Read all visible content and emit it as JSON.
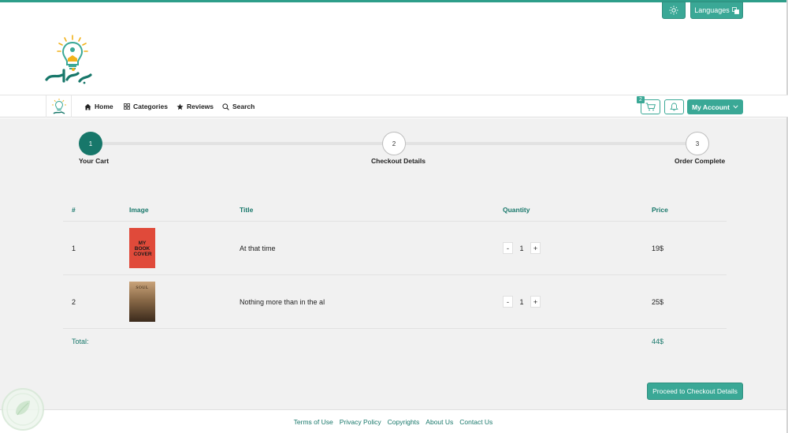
{
  "top": {
    "languages_label": "Languages"
  },
  "nav": {
    "items": [
      {
        "label": "Home",
        "icon": "home-icon"
      },
      {
        "label": "Categories",
        "icon": "grid-icon"
      },
      {
        "label": "Reviews",
        "icon": "star-icon"
      },
      {
        "label": "Search",
        "icon": "search-icon"
      }
    ],
    "cart_count": "2",
    "account_label": "My Account"
  },
  "steps": [
    {
      "number": "1",
      "label": "Your Cart",
      "active": true
    },
    {
      "number": "2",
      "label": "Checkout Details",
      "active": false
    },
    {
      "number": "3",
      "label": "Order Complete",
      "active": false
    }
  ],
  "table": {
    "headers": {
      "num": "#",
      "image": "Image",
      "title": "Title",
      "quantity": "Quantity",
      "price": "Price"
    },
    "rows": [
      {
        "num": "1",
        "cover_text": "MY BOOK COVER",
        "title": "At that time",
        "quantity": "1",
        "price": "19$"
      },
      {
        "num": "2",
        "cover_text": "SOUL",
        "title": "Nothing more than in the al",
        "quantity": "1",
        "price": "25$"
      }
    ],
    "minus": "-",
    "plus": "+",
    "total_label": "Total:",
    "total_value": "44$"
  },
  "proceed_label": "Proceed to Checkout Details",
  "footer": {
    "links": [
      "Terms of Use",
      "Privacy Policy",
      "Copyrights",
      "About Us",
      "Contact Us"
    ]
  },
  "colors": {
    "accent": "#3aa896",
    "accent_dark": "#17776a",
    "background": "#f1f1f1"
  }
}
